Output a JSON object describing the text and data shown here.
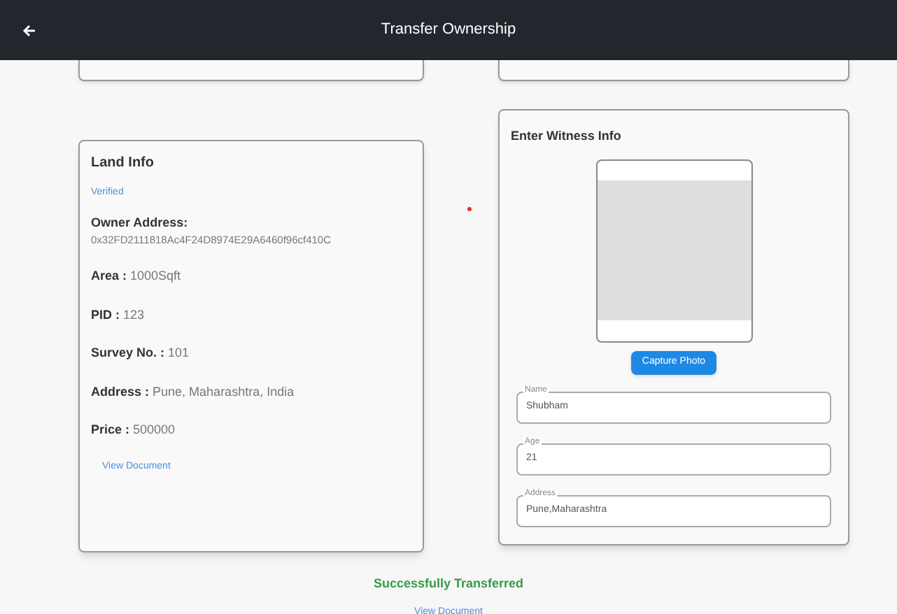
{
  "header": {
    "title": "Transfer Ownership"
  },
  "land_info": {
    "title": "Land Info",
    "status": "Verified",
    "owner_label": "Owner Address:",
    "owner_value": "0x32FD2111818Ac4F24D8974E29A6460f96cf410C",
    "fields": [
      {
        "label": "Area :",
        "value": "1000Sqft"
      },
      {
        "label": "PID :",
        "value": "123"
      },
      {
        "label": "Survey No. :",
        "value": "101"
      },
      {
        "label": "Address :",
        "value": "Pune, Maharashtra, India"
      },
      {
        "label": "Price :",
        "value": "500000"
      }
    ],
    "link": "View Document"
  },
  "witness": {
    "title": "Enter Witness Info",
    "capture_button": "Capture Photo",
    "fields": [
      {
        "label": "Name",
        "value": "Shubham"
      },
      {
        "label": "Age",
        "value": "21"
      },
      {
        "label": "Address",
        "value": "Pune,Maharashtra"
      }
    ]
  },
  "result": {
    "message": "Successfully Transferred",
    "link": "View Document"
  }
}
